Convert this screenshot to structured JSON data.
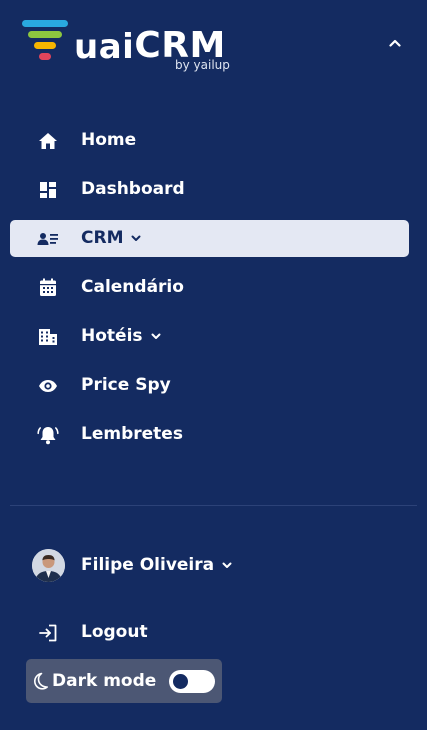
{
  "brand": {
    "name_lower": "uai",
    "name_upper": "CRM",
    "tagline": "by yailup",
    "funnel_colors": [
      "#29a9e0",
      "#8dc63f",
      "#f7b500",
      "#e2455b"
    ]
  },
  "nav": {
    "items": [
      {
        "label": "Home",
        "icon": "home-icon"
      },
      {
        "label": "Dashboard",
        "icon": "dashboard-icon"
      },
      {
        "label": "CRM",
        "icon": "contacts-icon",
        "active": true,
        "has_submenu": true
      },
      {
        "label": "Calendário",
        "icon": "calendar-icon"
      },
      {
        "label": "Hotéis",
        "icon": "building-icon",
        "has_submenu": true
      },
      {
        "label": "Price Spy",
        "icon": "eye-icon"
      },
      {
        "label": "Lembretes",
        "icon": "bell-icon"
      }
    ]
  },
  "user": {
    "name": "Filipe Oliveira"
  },
  "logout": {
    "label": "Logout",
    "icon": "logout-icon"
  },
  "dark_mode": {
    "label": "Dark mode",
    "enabled": false,
    "icon": "moon-icon"
  },
  "colors": {
    "sidebar_bg": "#142b61",
    "active_bg": "#e4e8f3",
    "dark_mode_bg": "#4c5774",
    "text": "#ffffff"
  }
}
